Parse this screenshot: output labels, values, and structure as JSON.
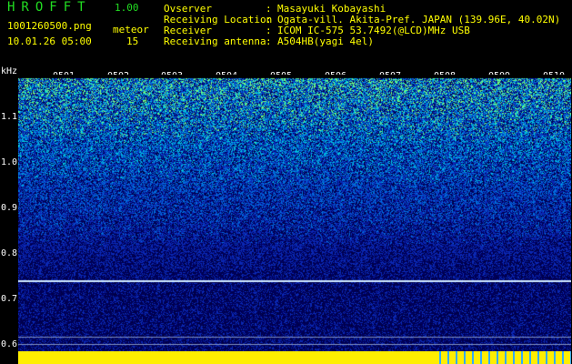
{
  "header": {
    "app_title": "HROFFT",
    "version": "1.00",
    "filename": "1001260500.png",
    "meteor_label": "meteor",
    "datetime": "10.01.26 05:00",
    "meteor_count": "15"
  },
  "info": {
    "observer_label": "Ovserver",
    "observer_value": "Masayuki Kobayashi",
    "location_label": "Receiving Location",
    "location_value": "Ogata-vill. Akita-Pref. JAPAN (139.96E, 40.02N)",
    "receiver_label": "Receiver",
    "receiver_value": "ICOM IC-575 53.7492(@LCD)MHz USB",
    "antenna_label": "Receiving antenna",
    "antenna_value": "A504HB(yagi 4el)",
    "colon": ":"
  },
  "axis": {
    "y_unit": "kHz",
    "y_ticks": [
      "1.1",
      "1.0",
      "0.9",
      "0.8",
      "0.7",
      "0.6"
    ],
    "x_ticks": [
      "0501",
      "0502",
      "0503",
      "0504",
      "0505",
      "0506",
      "0507",
      "0508",
      "0509",
      "0510"
    ]
  },
  "colors": {
    "background": "#000000",
    "green_text": "#22dd22",
    "yellow_text": "#ffff00",
    "noise_floor": "#0a1a8a",
    "bottom_bar": "#ffee00"
  }
}
